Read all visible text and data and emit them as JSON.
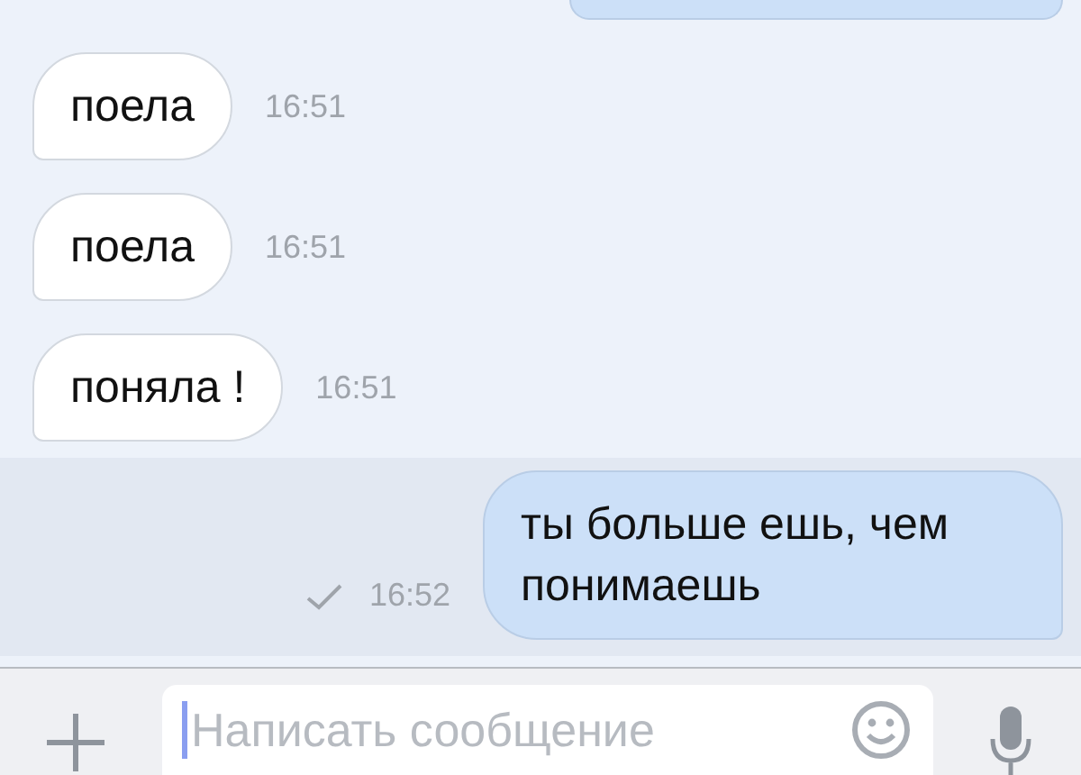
{
  "messages": [
    {
      "outgoing": true,
      "cut": true
    },
    {
      "outgoing": false,
      "text": "поела",
      "time": "16:51",
      "unread": false
    },
    {
      "outgoing": false,
      "text": "поела",
      "time": "16:51",
      "unread": false
    },
    {
      "outgoing": false,
      "text": "поняла !",
      "time": "16:51",
      "unread": false
    },
    {
      "outgoing": true,
      "text": "ты больше ешь, чем понимаешь",
      "time": "16:52",
      "unread": true,
      "read": false
    }
  ],
  "composer": {
    "placeholder": "Написать сообщение"
  }
}
